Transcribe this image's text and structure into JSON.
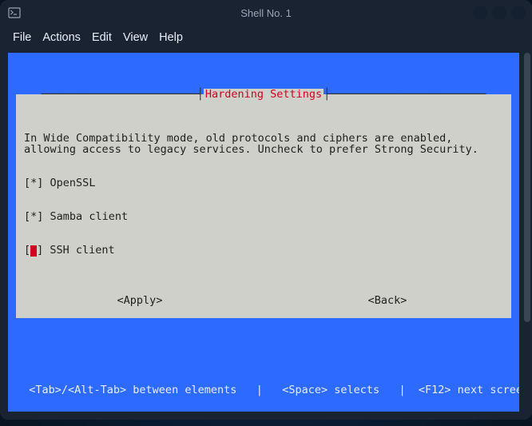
{
  "window": {
    "title": "Shell No. 1"
  },
  "menubar": {
    "file": "File",
    "actions": "Actions",
    "edit": "Edit",
    "view": "View",
    "help": "Help"
  },
  "dialog": {
    "title": "Hardening Settings",
    "description": "In Wide Compatibility mode, old protocols and ciphers are enabled,\nallowing access to legacy services. Uncheck to prefer Strong Security.",
    "items": [
      {
        "mark": "*",
        "label": "OpenSSL"
      },
      {
        "mark": "*",
        "label": "Samba client"
      },
      {
        "mark": " ",
        "label": "SSH client"
      }
    ],
    "apply": "<Apply>",
    "back": "<Back>"
  },
  "footer": "  <Tab>/<Alt-Tab> between elements   |   <Space> selects   |  <F12> next scree"
}
